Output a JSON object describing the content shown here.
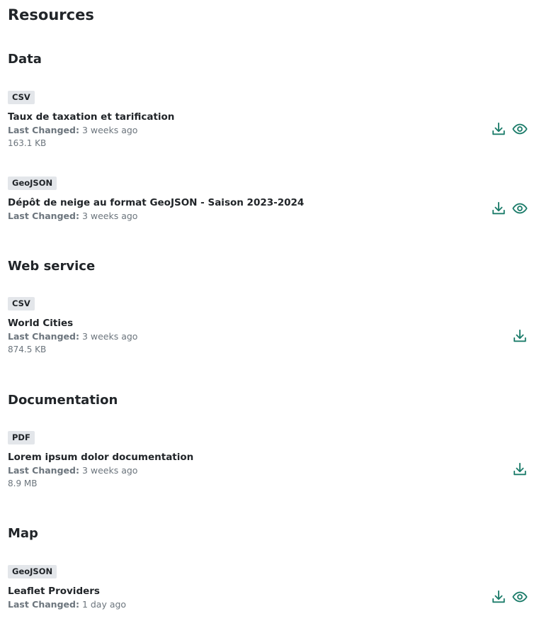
{
  "page_title": "Resources",
  "colors": {
    "accent": "#1c7c6a",
    "badge_bg": "#e3e6ea",
    "muted_text": "#6c757d"
  },
  "meta_label": "Last Changed:",
  "sections": [
    {
      "title": "Data",
      "resources": [
        {
          "format": "CSV",
          "name": "Taux de taxation et tarification",
          "last_changed": "3 weeks ago",
          "size": "163.1 KB",
          "icons": [
            "download-icon",
            "eye-icon"
          ]
        },
        {
          "format": "GeoJSON",
          "name": "Dépôt de neige au format GeoJSON - Saison 2023-2024",
          "last_changed": "3 weeks ago",
          "icons": [
            "download-icon",
            "eye-icon"
          ]
        }
      ]
    },
    {
      "title": "Web service",
      "resources": [
        {
          "format": "CSV",
          "name": "World Cities",
          "last_changed": "3 weeks ago",
          "size": "874.5 KB",
          "icons": [
            "download-icon"
          ]
        }
      ]
    },
    {
      "title": "Documentation",
      "resources": [
        {
          "format": "PDF",
          "name": "Lorem ipsum dolor documentation",
          "last_changed": "3 weeks ago",
          "size": "8.9 MB",
          "icons": [
            "download-icon"
          ]
        }
      ]
    },
    {
      "title": "Map",
      "resources": [
        {
          "format": "GeoJSON",
          "name": "Leaflet Providers",
          "last_changed": "1 day ago",
          "icons": [
            "download-icon",
            "eye-icon"
          ]
        }
      ]
    }
  ]
}
